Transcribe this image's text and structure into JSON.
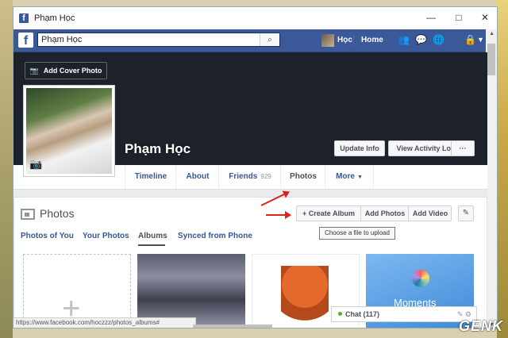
{
  "window": {
    "title": "Phạm Học"
  },
  "header": {
    "search_value": "Phạm Học",
    "user_name": "Học",
    "home_label": "Home"
  },
  "cover": {
    "add_cover_label": "Add Cover Photo",
    "profile_name": "Phạm Học",
    "update_info_label": "Update Info",
    "activity_log_label": "View Activity Log",
    "more_label": "···"
  },
  "tabs": [
    {
      "label": "Timeline"
    },
    {
      "label": "About"
    },
    {
      "label": "Friends",
      "count": "929"
    },
    {
      "label": "Photos"
    },
    {
      "label": "More"
    }
  ],
  "photos": {
    "title": "Photos",
    "create_album_label": "+ Create Album",
    "add_photos_label": "Add Photos",
    "add_video_label": "Add Video",
    "tooltip": "Choose a file to upload",
    "subtabs": [
      "Photos of You",
      "Your Photos",
      "Albums",
      "Synced from Phone"
    ],
    "moments_text": "Moments"
  },
  "chat": {
    "label": "Chat (117)"
  },
  "status_url": "https://www.facebook.com/hoczzz/photos_albums#",
  "watermark": "GENK",
  "colors": {
    "brand": "#3b5998",
    "cover_bg": "#1d2129",
    "arrow": "#e0201b"
  }
}
